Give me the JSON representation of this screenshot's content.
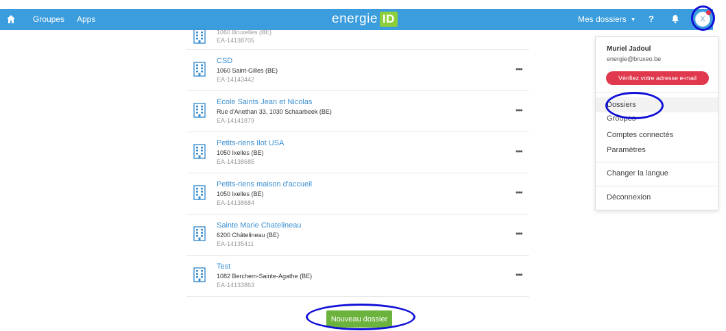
{
  "topbar": {
    "nav": [
      "Groupes",
      "Apps"
    ],
    "brand_text": "energie",
    "brand_badge": "ID",
    "my_dossiers": "Mes dossiers",
    "help": "?",
    "avatar_initial": "X"
  },
  "dossiers": [
    {
      "name": "1060 Bruxelles (BE)",
      "address": "",
      "code": "EA-14138705"
    },
    {
      "name": "CSD",
      "address": "1060 Saint-Gilles (BE)",
      "code": "EA-14143442"
    },
    {
      "name": "Ecole Saints Jean et Nicolas",
      "address": "Rue d'Anethan 33, 1030 Schaarbeek (BE)",
      "code": "EA-14141879"
    },
    {
      "name": "Petits-riens Ilot USA",
      "address": "1050 Ixelles (BE)",
      "code": "EA-14138685"
    },
    {
      "name": "Petits-riens maison d'accueil",
      "address": "1050 Ixelles (BE)",
      "code": "EA-14138684"
    },
    {
      "name": "Sainte Marie Chatelineau",
      "address": "6200 Châtelineau (BE)",
      "code": "EA-14135411"
    },
    {
      "name": "Test",
      "address": "1082 Berchem-Sainte-Agathe (BE)",
      "code": "EA-14133863"
    }
  ],
  "more_label": "•••",
  "new_dossier_label": "Nouveau dossier",
  "dropdown": {
    "user_name": "Muriel Jadoul",
    "email": "energie@bruxeo.be",
    "verify_label": "Vérifiez votre adresse e-mail",
    "items": [
      "Dossiers",
      "Groupes",
      "Comptes connectés",
      "Paramètres"
    ],
    "language": "Changer la langue",
    "logout": "Déconnexion"
  },
  "colors": {
    "topbar": "#3b9ddd",
    "brand_badge": "#8ccf3a",
    "link": "#3b8fd1",
    "verify": "#e0384c",
    "new_button": "#6cb33e",
    "annotation_ring": "#1010d8"
  },
  "icons": [
    "home-icon",
    "bell-icon",
    "building-icon",
    "caret-down-icon"
  ]
}
